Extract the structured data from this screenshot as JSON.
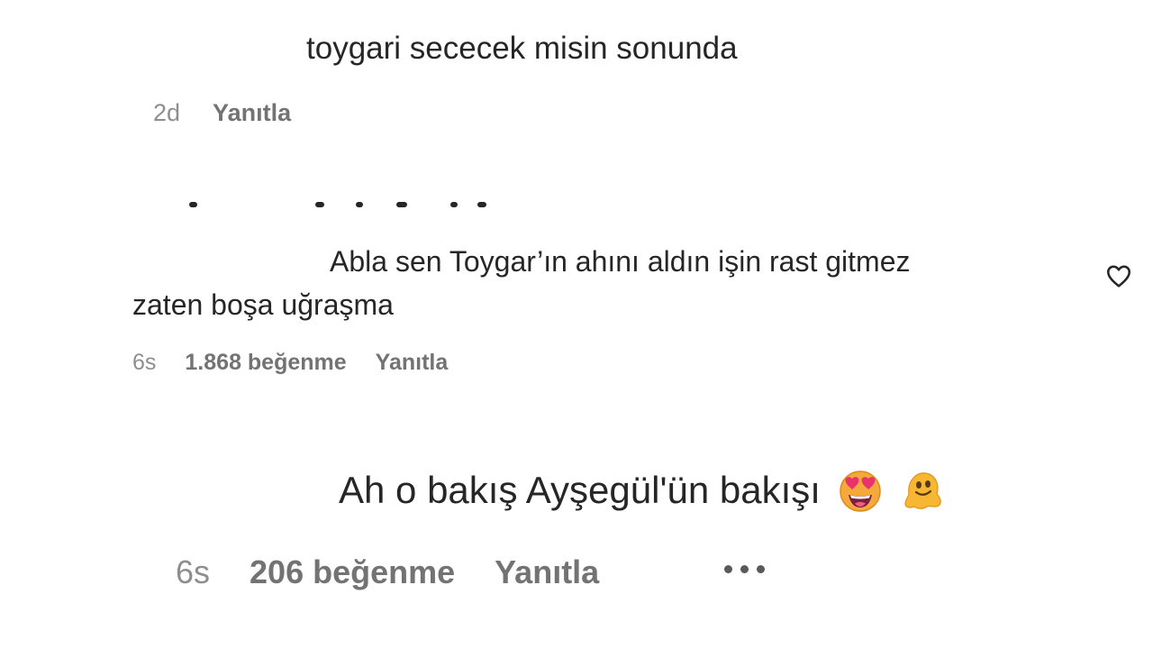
{
  "comments": [
    {
      "text_lines": [
        "toygari sececek misin sonunda"
      ],
      "time": "2d",
      "reply_label": "Yanıtla"
    },
    {
      "text_lines": [
        "Abla sen Toygar’ın ahını aldın işin rast gitmez",
        "zaten boşa uğraşma"
      ],
      "time": "6s",
      "likes": "1.868 beğenme",
      "reply_label": "Yanıtla",
      "like_icon": "heart-outline-icon"
    },
    {
      "text_lines": [
        "Ah o bakış Ayşegül'ün bakışı"
      ],
      "emojis": [
        "heart-eyes-emoji-icon",
        "melting-face-emoji-icon"
      ],
      "time": "6s",
      "likes": "206 beğenme",
      "reply_label": "Yanıtla",
      "more_icon": "more-options-icon"
    }
  ],
  "colors": {
    "text": "#262626",
    "meta_time": "#8e8e8e",
    "meta_link": "#737373",
    "emoji_face": "#f6a93b",
    "emoji_heart": "#e8336d",
    "melting_face": "#f7b733"
  }
}
